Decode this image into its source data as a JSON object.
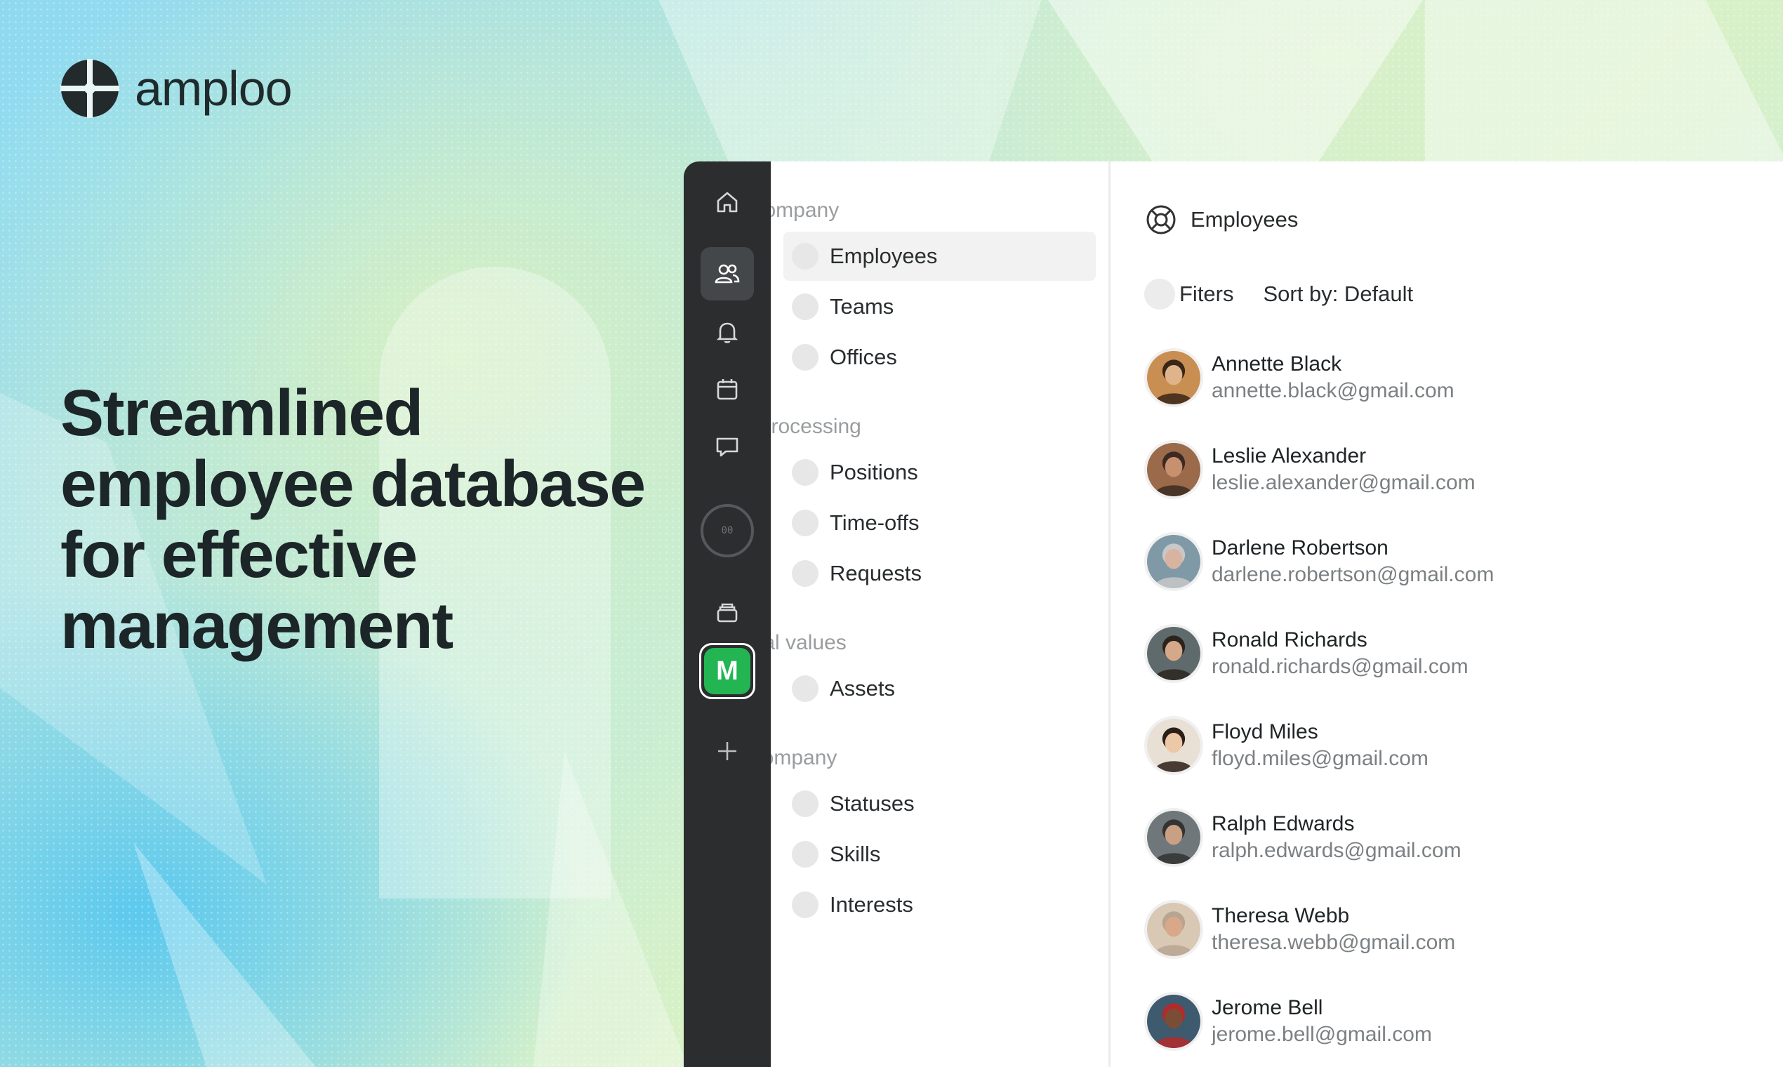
{
  "brand": {
    "name": "amploo"
  },
  "hero": {
    "headline": "Streamlined employee database for effective management"
  },
  "rail": {
    "icons": [
      "home-icon",
      "users-icon",
      "bell-icon",
      "calendar-icon",
      "chat-icon",
      "status-circle",
      "archive-icon",
      "workspace-badge",
      "plus-icon"
    ],
    "workspace_initial": "M",
    "workspace_color": "#22b552",
    "circle_text": "00"
  },
  "nav": {
    "groups": [
      {
        "title": "Stuff company",
        "items": [
          "Employees",
          "Teams",
          "Offices"
        ]
      },
      {
        "title": "Work processing",
        "items": [
          "Positions",
          "Time-offs",
          "Requests"
        ]
      },
      {
        "title": "Material values",
        "items": [
          "Assets"
        ]
      },
      {
        "title": "Utils company",
        "items": [
          "Statuses",
          "Skills",
          "Interests"
        ]
      }
    ],
    "active_item": "Employees"
  },
  "main": {
    "title": "Employees",
    "filters_label": "Fiters",
    "sort_label": "Sort by: Default",
    "employees": [
      {
        "name": "Annette Black",
        "email": "annette.black@gmail.com",
        "bg": "#c98f52",
        "skin": "#e0b48a",
        "hair": "#3a2618"
      },
      {
        "name": "Leslie Alexander",
        "email": "leslie.alexander@gmail.com",
        "bg": "#9b6a4a",
        "skin": "#c99070",
        "hair": "#3b2a22"
      },
      {
        "name": "Darlene Robertson",
        "email": "darlene.robertson@gmail.com",
        "bg": "#7f9aa6",
        "skin": "#d8b4a0",
        "hair": "#c8c8c8"
      },
      {
        "name": "Ronald Richards",
        "email": "ronald.richards@gmail.com",
        "bg": "#5f6a6c",
        "skin": "#d6a88a",
        "hair": "#2b241e"
      },
      {
        "name": "Floyd Miles",
        "email": "floyd.miles@gmail.com",
        "bg": "#e8dfd5",
        "skin": "#ecc8a8",
        "hair": "#2a1e16"
      },
      {
        "name": "Ralph Edwards",
        "email": "ralph.edwards@gmail.com",
        "bg": "#6f777a",
        "skin": "#c9a084",
        "hair": "#333333"
      },
      {
        "name": "Theresa Webb",
        "email": "theresa.webb@gmail.com",
        "bg": "#d9c8b4",
        "skin": "#d8a888",
        "hair": "#b7a592"
      },
      {
        "name": "Jerome Bell",
        "email": "jerome.bell@gmail.com",
        "bg": "#3d5a6e",
        "skin": "#7a4e36",
        "hair": "#b32a2a"
      }
    ]
  }
}
